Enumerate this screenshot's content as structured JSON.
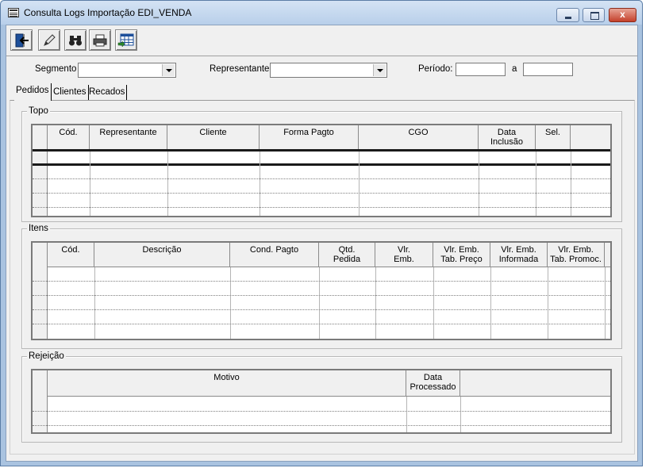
{
  "window": {
    "title": "Consulta Logs Importação EDI_VENDA",
    "close_glyph": "x"
  },
  "icons": {
    "toolbar": [
      "exit-door-icon",
      "edit-pencil-icon",
      "find-binoculars-icon",
      "print-printer-icon",
      "grid-export-icon"
    ]
  },
  "filters": {
    "segmento_label": "Segmento",
    "segmento_value": "",
    "representante_label": "Representante",
    "representante_value": "",
    "periodo_label": "Período:",
    "periodo_from": "",
    "periodo_sep": "a",
    "periodo_to": ""
  },
  "tabs": [
    "Pedidos",
    "Clientes",
    "Recados"
  ],
  "topo": {
    "label": "Topo",
    "columns": [
      "Cód.",
      "Representante",
      "Cliente",
      "Forma Pagto",
      "CGO",
      "Data\nInclusão",
      "Sel."
    ]
  },
  "itens": {
    "label": "Itens",
    "columns": [
      "Cód.",
      "Descrição",
      "Cond. Pagto",
      "Qtd.\nPedida",
      "Vlr.\nEmb.",
      "Vlr. Emb.\nTab. Preço",
      "Vlr. Emb.\nInformada",
      "Vlr. Emb.\nTab. Promoc."
    ]
  },
  "rejeicao": {
    "label": "Rejeição",
    "columns": [
      "Motivo",
      "Data\nProcessado"
    ]
  }
}
